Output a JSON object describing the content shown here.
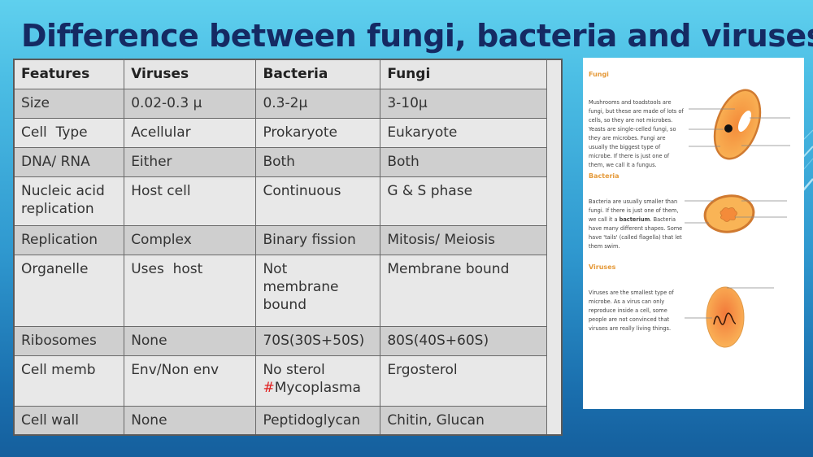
{
  "slide": {
    "title": "Difference between fungi, bacteria and viruses"
  },
  "table": {
    "headers": [
      "Features",
      "Viruses",
      "Bacteria",
      "Fungi"
    ],
    "rows": [
      {
        "feature": "Size",
        "viruses": "0.02-0.3 μ",
        "bacteria": "0.3-2μ",
        "fungi": "3-10μ"
      },
      {
        "feature": "Cell  Type",
        "viruses": "Acellular",
        "bacteria": "Prokaryote",
        "fungi": "Eukaryote"
      },
      {
        "feature": "DNA/ RNA",
        "viruses": "Either",
        "bacteria": "Both",
        "fungi": "Both"
      },
      {
        "feature": "Nucleic acid replication",
        "viruses": "Host cell",
        "bacteria": "Continuous",
        "fungi": "G & S phase"
      },
      {
        "feature": "Replication",
        "viruses": "Complex",
        "bacteria": "Binary fission",
        "fungi": "Mitosis/ Meiosis"
      },
      {
        "feature": "Organelle",
        "viruses": "Uses  host",
        "bacteria": "Not membrane bound",
        "fungi": "Membrane bound"
      },
      {
        "feature": "Ribosomes",
        "viruses": "None",
        "bacteria": "70S(30S+50S)",
        "fungi": "80S(40S+60S)"
      },
      {
        "feature": "Cell memb",
        "viruses": "Env/Non env",
        "bacteria_line1": "No sterol",
        "bacteria_hash": "#",
        "bacteria_line2": "Mycoplasma",
        "fungi": "Ergosterol"
      },
      {
        "feature": "Cell wall",
        "viruses": "None",
        "bacteria": "Peptidoglycan",
        "fungi": "Chitin, Glucan"
      }
    ]
  },
  "reference_image": {
    "sections": [
      {
        "heading": "Fungi",
        "text": "Mushrooms and toadstools are fungi, but these are made of lots of cells, so they are not microbes. Yeasts are single-celled fungi, so they are microbes. Fungi are usually the biggest type of microbe. If there is just one of them, we call it a fungus."
      },
      {
        "heading": "Bacteria",
        "text_before": "Bacteria are usually smaller than fungi. If there is just one of them, we call it a ",
        "text_bold": "bacterium",
        "text_after": ". Bacteria have many different shapes. Some have 'tails' (called flagella) that let them swim."
      },
      {
        "heading": "Viruses",
        "text": "Viruses are the smallest type of microbe. As a virus can only reproduce inside a cell, some people are not convinced that viruses are really living things."
      }
    ],
    "colors": {
      "heading": "#e59a3a",
      "cell_fill": "#f7b04c",
      "cell_edge": "#d07a30"
    }
  }
}
